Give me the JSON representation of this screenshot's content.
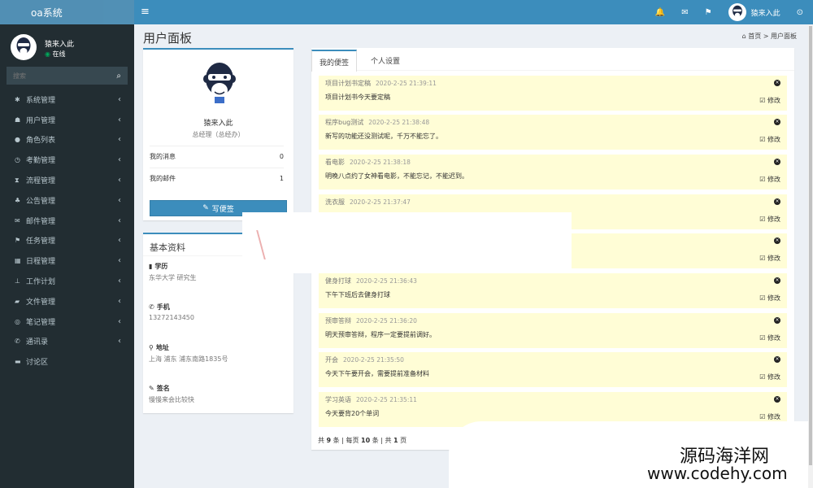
{
  "app": {
    "logo": "oa系统"
  },
  "header": {
    "username": "猿来入此"
  },
  "sidebar": {
    "user_name": "猿来入此",
    "status": "在线",
    "search_placeholder": "搜索",
    "items": [
      {
        "label": "系统管理",
        "icon": "gear-icon"
      },
      {
        "label": "用户管理",
        "icon": "users-icon"
      },
      {
        "label": "角色列表",
        "icon": "user-icon"
      },
      {
        "label": "考勤管理",
        "icon": "clock-icon"
      },
      {
        "label": "流程管理",
        "icon": "hourglass-icon"
      },
      {
        "label": "公告管理",
        "icon": "bell-icon"
      },
      {
        "label": "邮件管理",
        "icon": "envelope-icon"
      },
      {
        "label": "任务管理",
        "icon": "flag-icon"
      },
      {
        "label": "日程管理",
        "icon": "calendar-icon"
      },
      {
        "label": "工作计划",
        "icon": "pin-icon"
      },
      {
        "label": "文件管理",
        "icon": "folder-icon"
      },
      {
        "label": "笔记管理",
        "icon": "book-icon"
      },
      {
        "label": "通讯录",
        "icon": "phone-icon"
      },
      {
        "label": "讨论区",
        "icon": "comment-icon"
      }
    ]
  },
  "page": {
    "title": "用户面板",
    "breadcrumb_home": "首页",
    "breadcrumb_sep": ">",
    "breadcrumb_current": "用户面板"
  },
  "profile": {
    "name": "猿来入此",
    "role": "总经理（总经办）",
    "messages_label": "我的消息",
    "messages_count": "0",
    "mail_label": "我的邮件",
    "mail_count": "1",
    "write_note_label": "写便签"
  },
  "info": {
    "title": "基本资料",
    "education_label": "学历",
    "education_value": "东华大学 研究生",
    "phone_label": "手机",
    "phone_value": "13272143450",
    "address_label": "地址",
    "address_value": "上海 浦东 浦东南路1835号",
    "signature_label": "签名",
    "signature_value": "慢慢来会比较快"
  },
  "tabs": [
    {
      "label": "我的便签"
    },
    {
      "label": "个人设置"
    }
  ],
  "notes": [
    {
      "title": "项目计划书定稿",
      "date": "2020-2-25 21:39:11",
      "body": "项目计划书今天要定稿"
    },
    {
      "title": "程序bug测试",
      "date": "2020-2-25 21:38:48",
      "body": "新写的功能还没测试呢，千万不能忘了。"
    },
    {
      "title": "看电影",
      "date": "2020-2-25 21:38:18",
      "body": "明晚八点约了女神看电影，不能忘记，不能迟到。"
    },
    {
      "title": "洗衣服",
      "date": "2020-2-25 21:37:47",
      "body": ""
    },
    {
      "title": "",
      "date": "",
      "body": ""
    },
    {
      "title": "健身打球",
      "date": "2020-2-25 21:36:43",
      "body": "下午下班后去健身打球"
    },
    {
      "title": "预审答辩",
      "date": "2020-2-25 21:36:20",
      "body": "明天预审答辩，程序一定要提前调好。"
    },
    {
      "title": "开会",
      "date": "2020-2-25 21:35:50",
      "body": "今天下午要开会，需要提前准备材料"
    },
    {
      "title": "学习英语",
      "date": "2020-2-25 21:35:11",
      "body": "今天要背20个单词"
    }
  ],
  "note_edit_label": "修改",
  "pager": {
    "p1": "共",
    "total": "9",
    "p2": "条 | 每页",
    "per_page": "10",
    "p3": "条 | 共",
    "pages": "1",
    "p4": "页"
  },
  "watermark": {
    "line1": "源码海洋网",
    "line2": "www.codehy.com"
  }
}
